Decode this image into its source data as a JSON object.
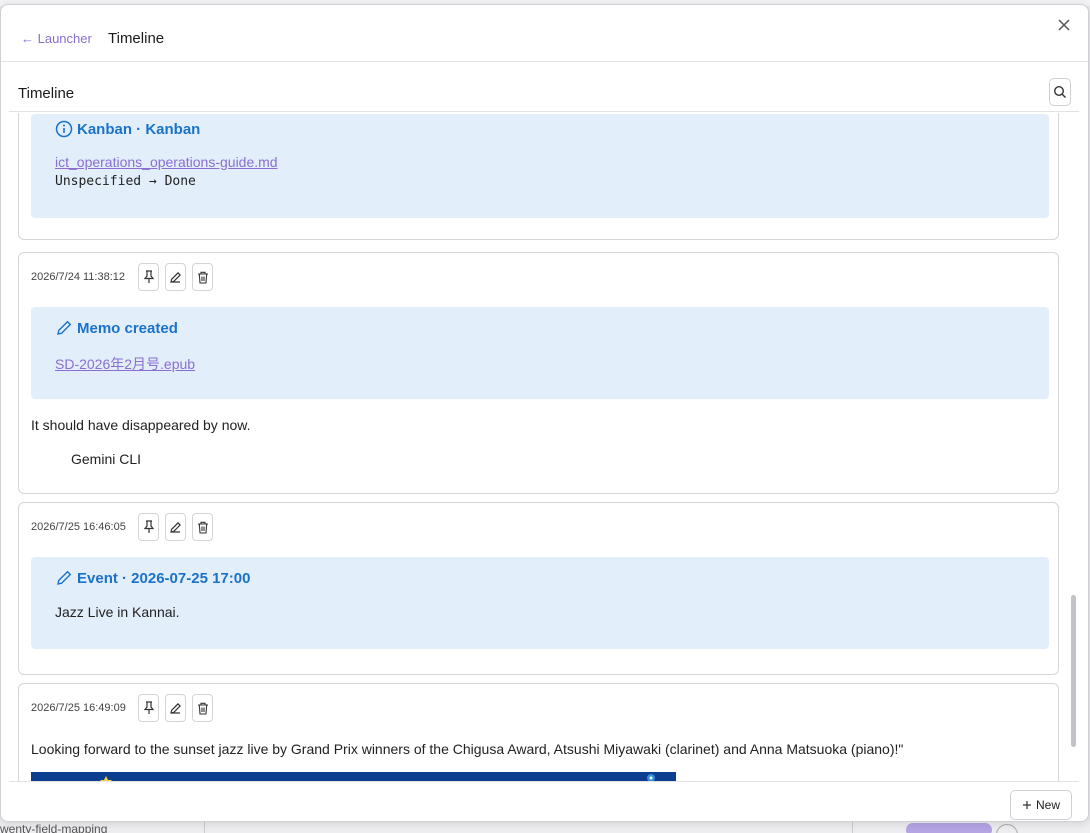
{
  "background": {
    "status_text": "wenty-field-mapping"
  },
  "header": {
    "back_label": "← Launcher",
    "title": "Timeline"
  },
  "subbar": {
    "title": "Timeline"
  },
  "entries": [
    {
      "type": "Kanban",
      "heading": "Kanban · Kanban",
      "file": "ict_operations_operations-guide.md",
      "status_change": "Unspecified → Done"
    },
    {
      "timestamp": "2026/7/24 11:38:12",
      "heading": "Memo created",
      "file": "SD-2026年2月号.epub",
      "body": "It should have disappeared by now.",
      "quote": "Gemini CLI"
    },
    {
      "timestamp": "2026/7/25 16:46:05",
      "heading": "Event · 2026-07-25 17:00",
      "body": "Jazz Live in Kannai."
    },
    {
      "timestamp": "2026/7/25 16:49:09",
      "body": "Looking forward to the sunset jazz live by Grand Prix winners of the Chigusa Award, Atsushi Miyawaki (clarinet) and Anna Matsuoka (piano)!\""
    }
  ],
  "footer": {
    "new_label": "New"
  },
  "colors": {
    "accent": "#8a6fd1",
    "info_blue": "#1a73c9",
    "info_bg": "#e3eefb"
  },
  "icons": [
    "close-icon",
    "search-icon",
    "info-icon",
    "pencil-icon",
    "pin-icon",
    "edit-icon",
    "trash-icon",
    "plus-icon"
  ]
}
